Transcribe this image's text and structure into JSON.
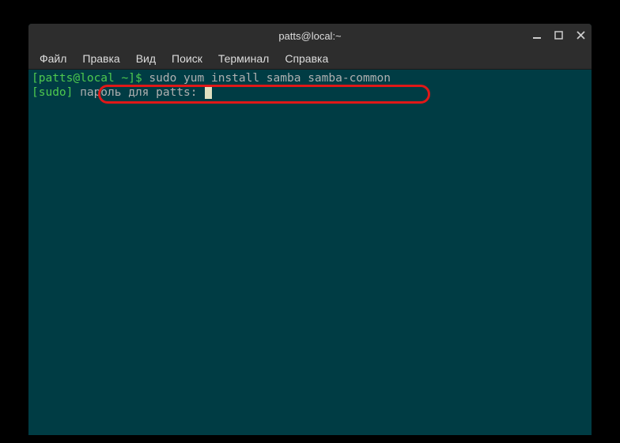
{
  "titlebar": {
    "title": "patts@local:~"
  },
  "menubar": {
    "items": [
      {
        "label": "Файл"
      },
      {
        "label": "Правка"
      },
      {
        "label": "Вид"
      },
      {
        "label": "Поиск"
      },
      {
        "label": "Терминал"
      },
      {
        "label": "Справка"
      }
    ]
  },
  "terminal": {
    "line1_prompt": "[patts@local ~]$ ",
    "line1_cmd": "sudo yum install samba samba-common",
    "line2_prefix": "[sudo] ",
    "line2_msg": "пароль для patts: "
  }
}
